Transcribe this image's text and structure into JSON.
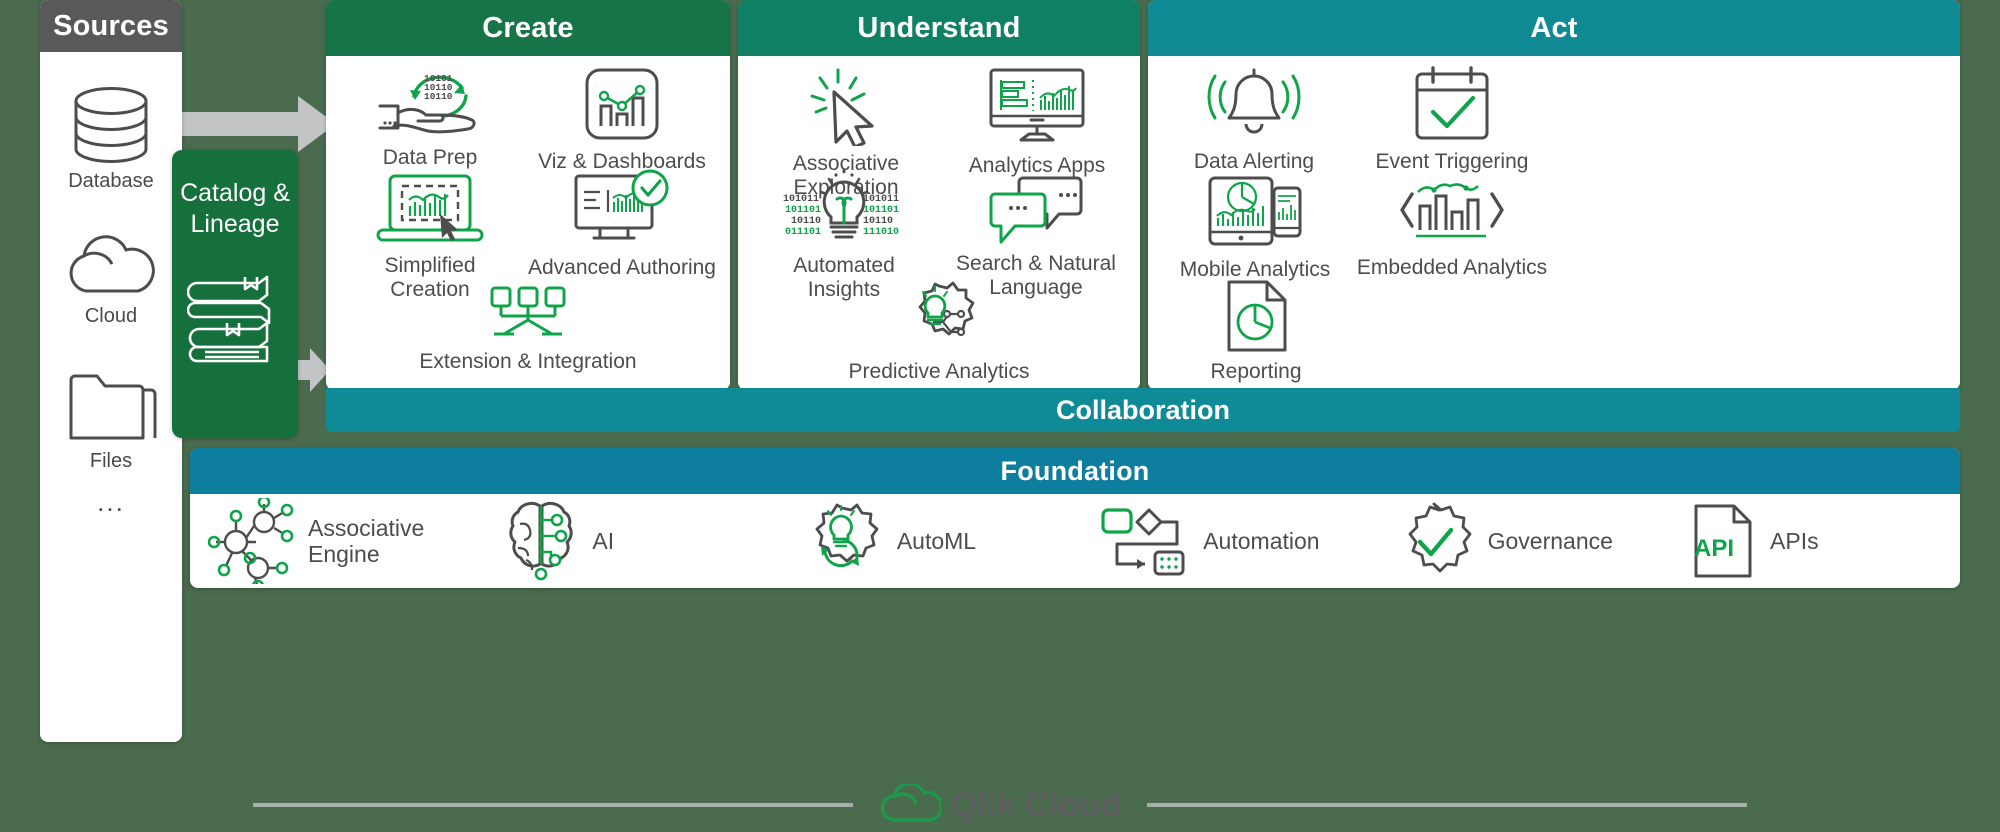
{
  "sources": {
    "title": "Sources",
    "items": [
      {
        "label": "Database",
        "icon": "database-icon"
      },
      {
        "label": "Cloud",
        "icon": "cloud-icon"
      },
      {
        "label": "Files",
        "icon": "folder-icon"
      }
    ],
    "more": "..."
  },
  "catalog": {
    "title": "Catalog &\nLineage",
    "icon": "books-stack-icon"
  },
  "create": {
    "title": "Create",
    "items": [
      {
        "label": "Data Prep",
        "icon": "data-prep-hand-icon"
      },
      {
        "label": "Viz & Dashboards",
        "icon": "bar-line-chart-icon"
      },
      {
        "label": "Simplified\nCreation",
        "icon": "laptop-chart-cursor-icon"
      },
      {
        "label": "Advanced Authoring",
        "icon": "monitor-check-icon"
      },
      {
        "label": "Extension & Integration",
        "icon": "nodes-extension-icon"
      }
    ]
  },
  "understand": {
    "title": "Understand",
    "items": [
      {
        "label": "Associative Exploration",
        "icon": "click-cursor-sparkle-icon"
      },
      {
        "label": "Analytics Apps",
        "icon": "monitor-analytics-icon"
      },
      {
        "label": "Automated\nInsights",
        "icon": "lightbulb-binary-icon"
      },
      {
        "label": "Search & Natural\nLanguage",
        "icon": "chat-bubbles-icon"
      },
      {
        "label": "Predictive Analytics",
        "icon": "gear-bulb-network-icon"
      }
    ]
  },
  "act": {
    "title": "Act",
    "items": [
      {
        "label": "Data Alerting",
        "icon": "bell-alert-icon"
      },
      {
        "label": "Event Triggering",
        "icon": "calendar-check-icon"
      },
      {
        "label": "Mobile Analytics",
        "icon": "tablet-phone-charts-icon"
      },
      {
        "label": "Embedded Analytics",
        "icon": "embed-brackets-chart-icon"
      },
      {
        "label": "Reporting",
        "icon": "report-pie-document-icon"
      }
    ]
  },
  "collaboration": {
    "title": "Collaboration"
  },
  "foundation": {
    "title": "Foundation",
    "items": [
      {
        "label": "Associative\nEngine",
        "icon": "network-nodes-icon"
      },
      {
        "label": "AI",
        "icon": "brain-circuit-icon"
      },
      {
        "label": "AutoML",
        "icon": "gear-bulb-refresh-icon"
      },
      {
        "label": "Automation",
        "icon": "flow-shapes-icon"
      },
      {
        "label": "Governance",
        "icon": "badge-check-icon"
      },
      {
        "label": "APIs",
        "icon": "api-document-icon"
      }
    ]
  },
  "footer": {
    "brand": "Qlik Cloud",
    "icon": "cloud-outline-icon"
  },
  "colors": {
    "background": "#4a6b4e",
    "sources_header": "#58595b",
    "catalog": "#16703c",
    "create_header": "#177449",
    "understand_header": "#108064",
    "act_header": "#0f8a93",
    "collaboration": "#0e8b96",
    "foundation_header": "#0d7e9e",
    "icon_green": "#10a44a",
    "icon_gray": "#4d4d4d",
    "arrow_gray": "#c3c4c6"
  }
}
